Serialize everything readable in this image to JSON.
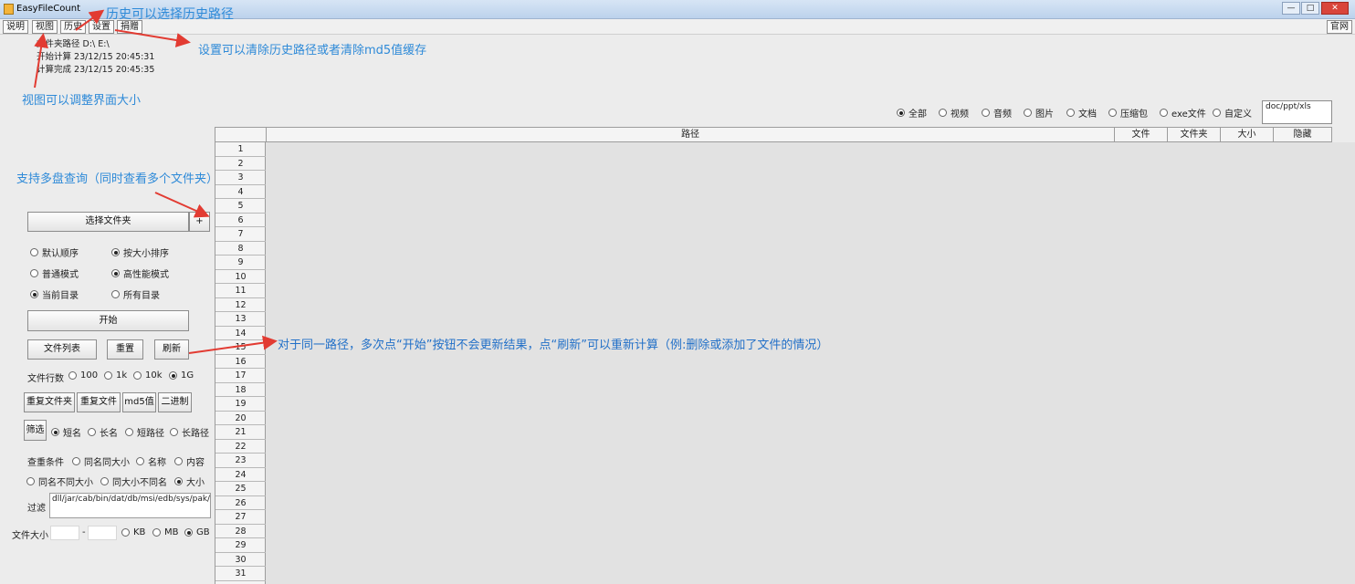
{
  "window": {
    "title": "EasyFileCount",
    "minimize_label": "—",
    "maximize_label": "□",
    "close_label": "✕"
  },
  "menu": {
    "items": [
      "说明",
      "视图",
      "历史",
      "设置",
      "捐赠"
    ],
    "right_item": "官网"
  },
  "info": {
    "folder_path": "文件夹路径 D:\\    E:\\",
    "start_time": "开始计算 23/12/15 20:45:31",
    "end_time": "计算完成 23/12/15 20:45:35"
  },
  "annotations": {
    "history": "历史可以选择历史路径",
    "settings": "设置可以清除历史路径或者清除md5值缓存",
    "view": "视图可以调整界面大小",
    "multi_disk": "支持多盘查询（同时查看多个文件夹）",
    "refresh": "对于同一路径，多次点“开始”按钮不会更新结果，点“刷新”可以重新计算（例:删除或添加了文件的情况）",
    "color": "#2e8ad8"
  },
  "file_types": {
    "options": [
      "全部",
      "视频",
      "音频",
      "图片",
      "文档",
      "压缩包",
      "exe文件",
      "自定义"
    ],
    "selected": "全部",
    "custom_ext": "doc/ppt/xls"
  },
  "table": {
    "columns": [
      "路径",
      "文件",
      "文件夹",
      "大小",
      "隐藏"
    ],
    "row_numbers": [
      "1",
      "2",
      "3",
      "4",
      "5",
      "6",
      "7",
      "8",
      "9",
      "10",
      "11",
      "12",
      "13",
      "14",
      "15",
      "16",
      "17",
      "18",
      "19",
      "20",
      "21",
      "22",
      "23",
      "24",
      "25",
      "26",
      "27",
      "28",
      "29",
      "30",
      "31"
    ]
  },
  "controls": {
    "choose_folder": "选择文件夹",
    "add_folder": "+",
    "sort_default": "默认顺序",
    "sort_size": "按大小排序",
    "mode_normal": "普通模式",
    "mode_high": "高性能模式",
    "scope_current": "当前目录",
    "scope_all": "所有目录",
    "start": "开始",
    "file_list": "文件列表",
    "reset": "重置",
    "refresh": "刷新",
    "row_count_label": "文件行数",
    "row_count_options": [
      "100",
      "1k",
      "10k",
      "1G"
    ],
    "row_count_selected": "1G",
    "dup_folder": "重复文件夹",
    "dup_file": "重复文件",
    "md5": "md5值",
    "binary": "二进制",
    "filter": "筛选",
    "name_options": [
      "短名",
      "长名",
      "短路径",
      "长路径"
    ],
    "name_selected": "短名",
    "dup_condition_label": "查重条件",
    "dup_conditions_row1": [
      "同名同大小",
      "名称",
      "内容"
    ],
    "dup_conditions_row2": [
      "同名不同大小",
      "同大小不同名",
      "大小"
    ],
    "dup_condition_selected": "大小",
    "exclude_label": "过滤",
    "exclude_value": "dll/jar/cab/bin/dat/db/msi/edb/sys/pak/jsa",
    "size_label": "文件大小",
    "size_dash": "-",
    "size_units": [
      "KB",
      "MB",
      "GB"
    ],
    "size_unit_selected": "GB"
  }
}
